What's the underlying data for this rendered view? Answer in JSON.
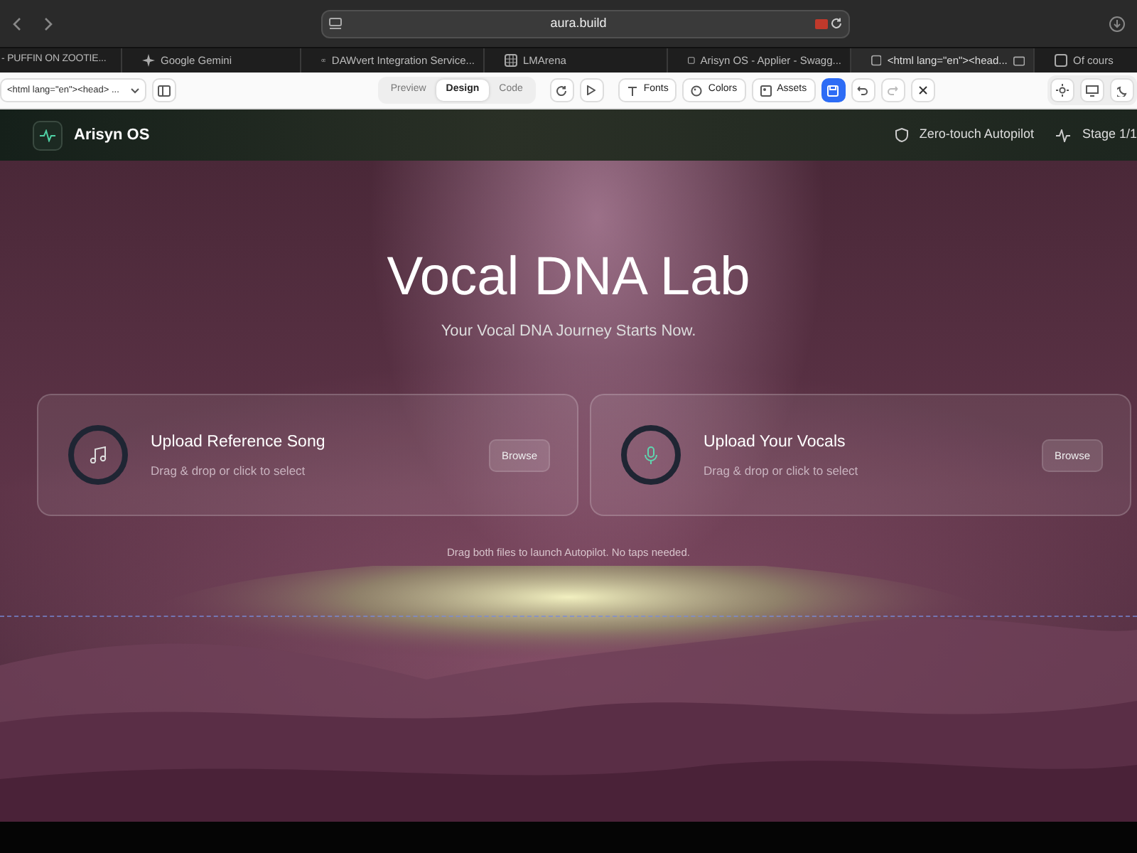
{
  "browser": {
    "address": "aura.build",
    "tabs": [
      {
        "label": "- PUFFIN ON ZOOTIE...",
        "selected": false
      },
      {
        "label": "Google Gemini",
        "selected": false
      },
      {
        "label": "DAWvert Integration Service...",
        "selected": false
      },
      {
        "label": "LMArena",
        "selected": false
      },
      {
        "label": "Arisyn OS - Applier - Swagg...",
        "selected": false
      },
      {
        "label": "<html lang=\"en\"><head...",
        "selected": true
      },
      {
        "label": "Of cours",
        "selected": false
      }
    ]
  },
  "toolbar": {
    "file_select": "<html lang=\"en\"><head> ...",
    "views": [
      {
        "label": "Preview",
        "selected": false
      },
      {
        "label": "Design",
        "selected": true
      },
      {
        "label": "Code",
        "selected": false
      }
    ],
    "buttons": [
      {
        "label": "Fonts",
        "kind": "fonts"
      },
      {
        "label": "Colors",
        "kind": "colors"
      },
      {
        "label": "Assets",
        "kind": "assets"
      }
    ]
  },
  "app": {
    "name": "Arisyn OS",
    "autopilot": "Zero-touch Autopilot",
    "stage": "Stage 1/1"
  },
  "hero": {
    "title": "Vocal DNA Lab",
    "subtitle": "Your Vocal DNA Journey Starts Now.",
    "uploads": [
      {
        "kind": "song",
        "title": "Upload Reference Song",
        "hint": "Drag & drop or click to select",
        "button": "Browse"
      },
      {
        "kind": "vocals",
        "title": "Upload Your Vocals",
        "hint": "Drag & drop or click to select",
        "button": "Browse"
      }
    ],
    "note": "Drag both files to launch Autopilot. No taps needed."
  }
}
